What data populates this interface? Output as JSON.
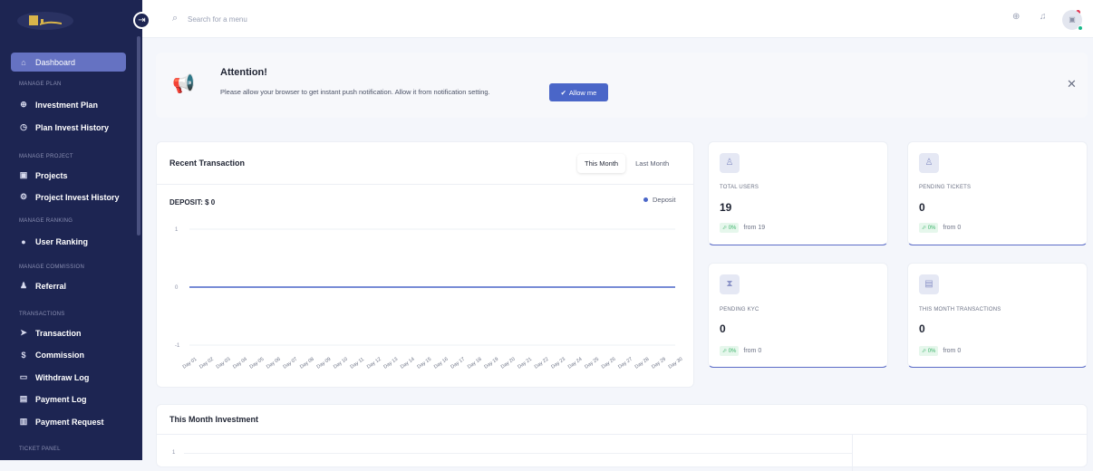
{
  "sidebar": {
    "collapse_icon": "collapse-icon",
    "logo": "brand-logo",
    "items": [
      {
        "label": "Dashboard",
        "icon": "home-icon",
        "active": true
      },
      {
        "label": "Investment Plan",
        "icon": "plan-icon"
      },
      {
        "label": "Plan Invest History",
        "icon": "clock-icon"
      },
      {
        "label": "Projects",
        "icon": "projects-icon"
      },
      {
        "label": "Project Invest History",
        "icon": "history-icon"
      },
      {
        "label": "User Ranking",
        "icon": "ranking-icon"
      },
      {
        "label": "Referral",
        "icon": "referral-icon"
      },
      {
        "label": "Transaction",
        "icon": "send-icon"
      },
      {
        "label": "Commission",
        "icon": "dollar-icon"
      },
      {
        "label": "Withdraw Log",
        "icon": "wallet-icon"
      },
      {
        "label": "Payment Log",
        "icon": "card-icon"
      },
      {
        "label": "Payment Request",
        "icon": "request-icon"
      }
    ],
    "sections": [
      "MANAGE PLAN",
      "MANAGE PROJECT",
      "MANAGE RANKING",
      "MANAGE COMMISSION",
      "TRANSACTIONS",
      "TICKET PANEL"
    ]
  },
  "search": {
    "placeholder": "Search for a menu"
  },
  "alert": {
    "title": "Attention!",
    "text": "Please allow your browser to get instant push notification. Allow it from notification setting.",
    "button": "Allow me"
  },
  "recent": {
    "title": "Recent Transaction",
    "tabs": [
      "This Month",
      "Last Month"
    ],
    "deposit_label": "DEPOSIT: $ 0",
    "legend": "Deposit"
  },
  "stats": [
    {
      "label": "TOTAL USERS",
      "value": "19",
      "trend": "0%",
      "from": "from 19"
    },
    {
      "label": "PENDING TICKETS",
      "value": "0",
      "trend": "0%",
      "from": "from 0"
    },
    {
      "label": "PENDING KYC",
      "value": "0",
      "trend": "0%",
      "from": "from 0"
    },
    {
      "label": "THIS MONTH TRANSACTIONS",
      "value": "0",
      "trend": "0%",
      "from": "from 0"
    }
  ],
  "investment": {
    "title": "This Month Investment",
    "tick": "1"
  },
  "colors": {
    "sidebar": "#1d2552",
    "accent": "#4a66c8",
    "active_nav": "#6572c2"
  },
  "chart_data": {
    "type": "line",
    "categories": [
      "Day 01",
      "Day 02",
      "Day 03",
      "Day 04",
      "Day 05",
      "Day 06",
      "Day 07",
      "Day 08",
      "Day 09",
      "Day 10",
      "Day 11",
      "Day 12",
      "Day 13",
      "Day 14",
      "Day 15",
      "Day 16",
      "Day 17",
      "Day 18",
      "Day 19",
      "Day 20",
      "Day 21",
      "Day 22",
      "Day 23",
      "Day 24",
      "Day 25",
      "Day 26",
      "Day 27",
      "Day 28",
      "Day 29",
      "Day 30"
    ],
    "series": [
      {
        "name": "Deposit",
        "values": [
          0,
          0,
          0,
          0,
          0,
          0,
          0,
          0,
          0,
          0,
          0,
          0,
          0,
          0,
          0,
          0,
          0,
          0,
          0,
          0,
          0,
          0,
          0,
          0,
          0,
          0,
          0,
          0,
          0,
          0
        ]
      }
    ],
    "yticks": [
      "1",
      "0",
      "-1"
    ],
    "ylim": [
      -1,
      1
    ],
    "grid": true,
    "legend": "top-right"
  }
}
